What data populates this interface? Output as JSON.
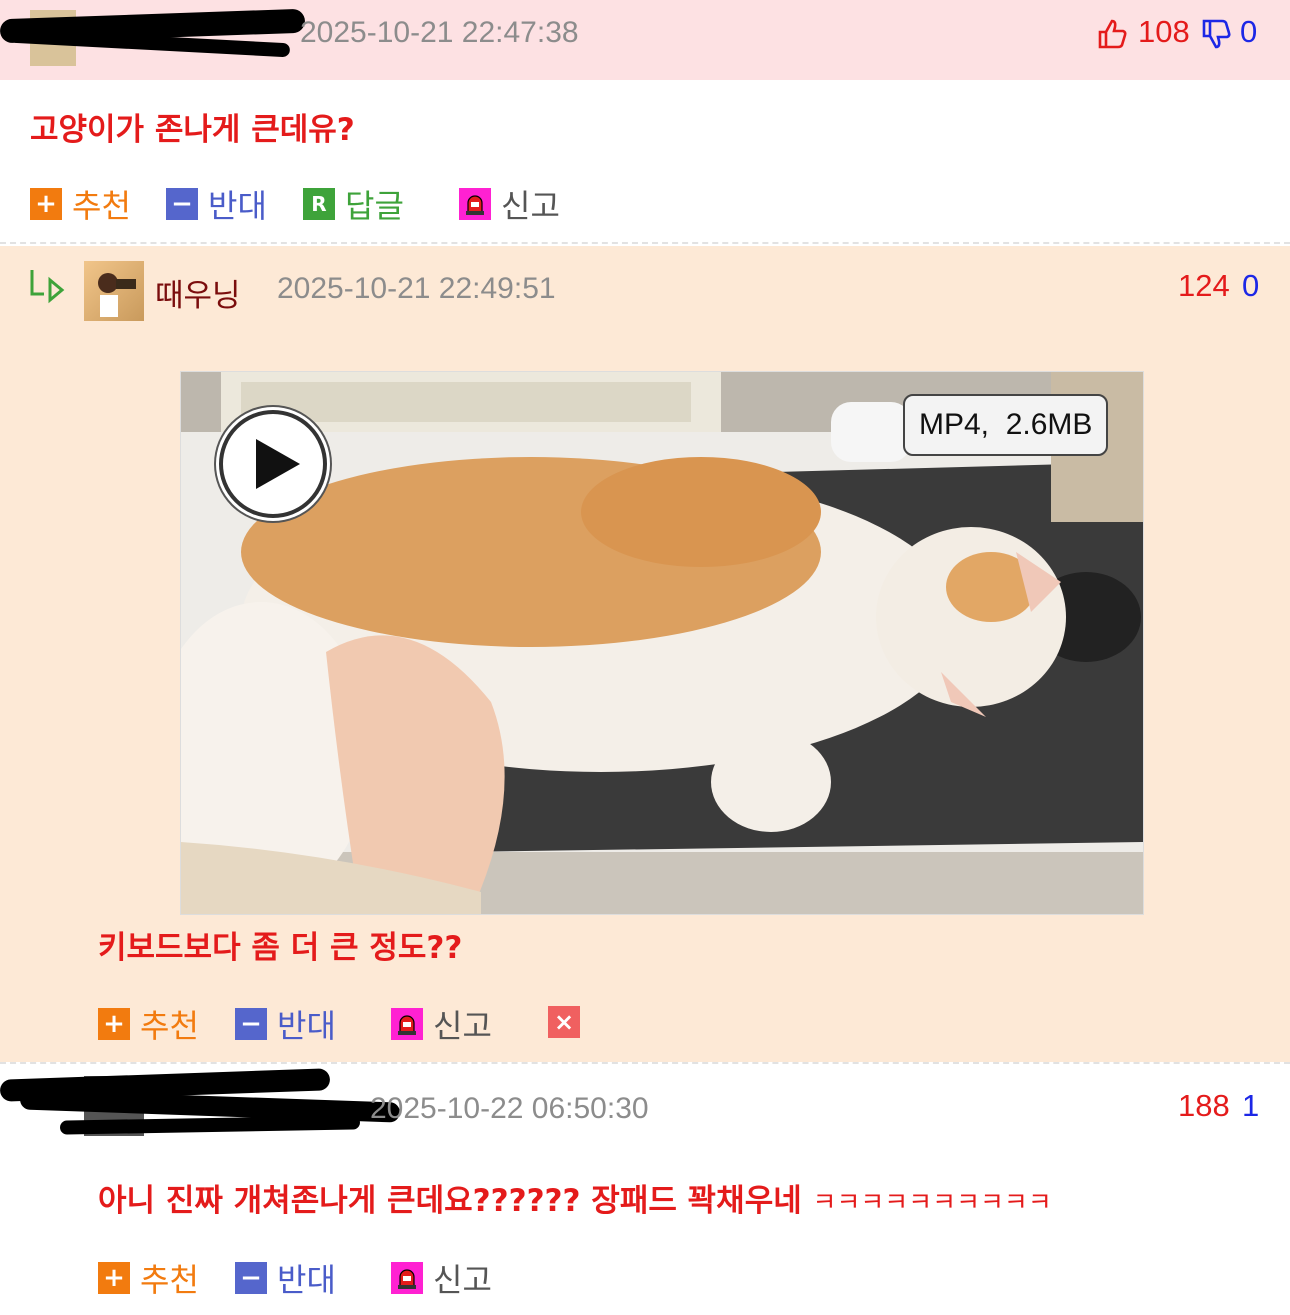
{
  "comment1": {
    "timestamp": "2025-10-21 22:47:38",
    "likes": "108",
    "dislikes": "0",
    "text": "고양이가 존나게 큰데유?",
    "actions": {
      "recommend": "추천",
      "oppose": "반대",
      "reply": "답글",
      "report": "신고"
    },
    "colors": {
      "bg": "#fde1e3"
    }
  },
  "comment2": {
    "username": "때우닝",
    "timestamp": "2025-10-21 22:49:51",
    "likes": "124",
    "dislikes": "0",
    "video": {
      "badge": "MP4,  2.6MB",
      "icon": "play-icon"
    },
    "text": "키보드보다 좀 더 큰 정도??",
    "actions": {
      "recommend": "추천",
      "oppose": "반대",
      "report": "신고"
    },
    "colors": {
      "bg": "#fde9d6"
    }
  },
  "comment3": {
    "timestamp": "2025-10-22 06:50:30",
    "likes": "188",
    "dislikes": "1",
    "text": "아니 진짜 개쳐존나게 큰데요?????? 장패드 꽉채우네",
    "laugh": "ㅋㅋㅋㅋㅋㅋㅋㅋㅋㅋ",
    "actions": {
      "recommend": "추천",
      "oppose": "반대",
      "report": "신고"
    }
  }
}
